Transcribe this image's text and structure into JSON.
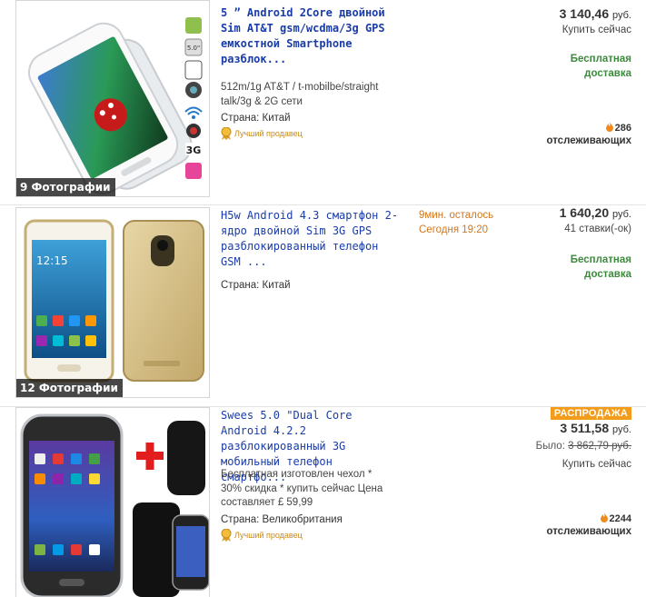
{
  "listings": [
    {
      "photo_count": "9 Фотографии",
      "title": "5 ” Android 2Core двойной Sim AT&T gsm/wcdma/3g GPS емкостной Smartphone разблок...",
      "description": "512m/1g AT&T / t-mobilbe/straight talk/3g & 2G сети",
      "country": "Страна: Китай",
      "seller_badge": "Лучший продавец",
      "price": "3 140,46",
      "currency": "руб.",
      "buy_label": "Купить сейчас",
      "shipping": "Бесплатная доставка",
      "watchers_count": "286",
      "watchers_label": "отслеживающих"
    },
    {
      "photo_count": "12 Фотографии",
      "title": "H5w Android 4.3 смартфон 2-ядро двойной Sim 3G GPS разблокированный телефон GSM ...",
      "country": "Страна: Китай",
      "time_left": "9мин. осталось",
      "time_end": "Сегодня 19:20",
      "price": "1 640,20",
      "currency": "руб.",
      "bids": "41 ставки(-ок)",
      "shipping": "Бесплатная доставка"
    },
    {
      "title": "Swees 5.0 \"Dual Core Android 4.2.2 разблокированный 3G мобильный телефон смартфо...",
      "description": "Бесплатная изготовлен чехол * 30% скидка * купить сейчас Цена составляет £ 59,99",
      "country": "Страна: Великобритания",
      "seller_badge": "Лучший продавец",
      "sale_badge": "РАСПРОДАЖА",
      "price": "3 511,58",
      "currency": "руб.",
      "was_label": "Было:",
      "was_price": "3 862,79 руб.",
      "buy_label": "Купить сейчас",
      "watchers_count": "2244",
      "watchers_label": "отслеживающих"
    }
  ],
  "colors": {
    "link": "#1a3ca8",
    "shipping": "#3c8b3c",
    "time": "#d0771d",
    "sale": "#f39b1a"
  }
}
